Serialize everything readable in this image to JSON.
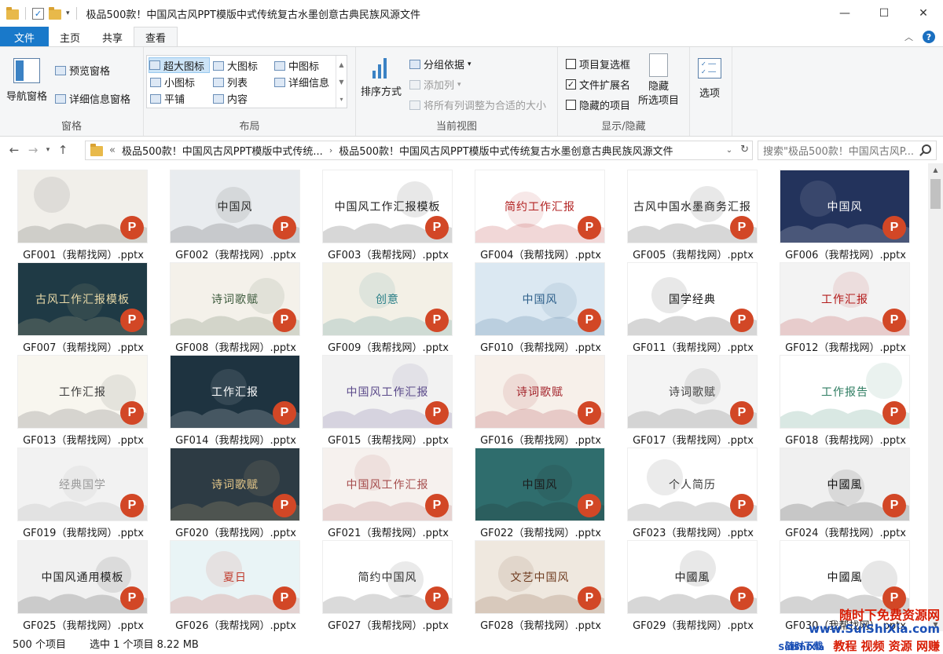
{
  "window": {
    "title": "极品500款！中国风古风PPT模版中式传统复古水墨创意古典民族风源文件",
    "controls": {
      "minimize": "—",
      "maximize": "☐",
      "close": "✕"
    }
  },
  "ribbon_tabs": [
    "文件",
    "主页",
    "共享",
    "查看"
  ],
  "ribbon": {
    "panes": {
      "label": "窗格",
      "nav_pane": "导航窗格",
      "preview_pane": "预览窗格",
      "details_pane": "详细信息窗格"
    },
    "layout": {
      "label": "布局",
      "options": [
        "超大图标",
        "大图标",
        "中图标",
        "小图标",
        "列表",
        "详细信息",
        "平铺",
        "内容"
      ],
      "selected": "超大图标"
    },
    "current_view": {
      "label": "当前视图",
      "sort_by": "排序方式",
      "group_by": "分组依据",
      "add_columns": "添加列",
      "size_all_columns": "将所有列调整为合适的大小"
    },
    "show_hide": {
      "label": "显示/隐藏",
      "item_checkboxes": {
        "label": "项目复选框",
        "checked": false
      },
      "file_extensions": {
        "label": "文件扩展名",
        "checked": true
      },
      "hidden_items": {
        "label": "隐藏的项目",
        "checked": false
      },
      "hide_selected": "隐藏\n所选项目"
    },
    "options": "选项"
  },
  "address": {
    "crumb_prefix": "«",
    "crumb1": "极品500款！中国风古风PPT模版中式传统...",
    "crumb2": "极品500款！中国风古风PPT模版中式传统复古水墨创意古典民族风源文件",
    "search_placeholder": "搜索\"极品500款！中国风古风P..."
  },
  "files": [
    {
      "name": "GF001（我帮找网）.pptx",
      "thumb_text": "",
      "bg": "#f1efea",
      "accent": "#3a3a3a"
    },
    {
      "name": "GF002（我帮找网）.pptx",
      "thumb_text": "中国风",
      "bg": "#e9ecef",
      "accent": "#2b2b2b"
    },
    {
      "name": "GF003（我帮找网）.pptx",
      "thumb_text": "中国风工作汇报模板",
      "bg": "#ffffff",
      "accent": "#222222"
    },
    {
      "name": "GF004（我帮找网）.pptx",
      "thumb_text": "简约工作汇报",
      "bg": "#ffffff",
      "accent": "#b22222"
    },
    {
      "name": "GF005（我帮找网）.pptx",
      "thumb_text": "古风中国水墨商务汇报",
      "bg": "#ffffff",
      "accent": "#222222"
    },
    {
      "name": "GF006（我帮找网）.pptx",
      "thumb_text": "中国风",
      "bg": "#23335c",
      "accent": "#ffffff"
    },
    {
      "name": "GF007（我帮找网）.pptx",
      "thumb_text": "古风工作汇报模板",
      "bg": "#1f3a45",
      "accent": "#e8d9a8"
    },
    {
      "name": "GF008（我帮找网）.pptx",
      "thumb_text": "诗词歌赋",
      "bg": "#f4f1ea",
      "accent": "#3c5a3c"
    },
    {
      "name": "GF009（我帮找网）.pptx",
      "thumb_text": "创意",
      "bg": "#f3f0e6",
      "accent": "#2a7f87"
    },
    {
      "name": "GF010（我帮找网）.pptx",
      "thumb_text": "中国风",
      "bg": "#dbe8f2",
      "accent": "#2d5f8a"
    },
    {
      "name": "GF011（我帮找网）.pptx",
      "thumb_text": "国学经典",
      "bg": "#ffffff",
      "accent": "#1b1b1b"
    },
    {
      "name": "GF012（我帮找网）.pptx",
      "thumb_text": "工作汇报",
      "bg": "#f3f3f3",
      "accent": "#b31b1b"
    },
    {
      "name": "GF013（我帮找网）.pptx",
      "thumb_text": "工作汇报",
      "bg": "#f8f6ef",
      "accent": "#3b3b3b"
    },
    {
      "name": "GF014（我帮找网）.pptx",
      "thumb_text": "工作汇报",
      "bg": "#1e3340",
      "accent": "#ffffff"
    },
    {
      "name": "GF015（我帮找网）.pptx",
      "thumb_text": "中国风工作汇报",
      "bg": "#f2f2f2",
      "accent": "#5b4a8a"
    },
    {
      "name": "GF016（我帮找网）.pptx",
      "thumb_text": "诗词歌赋",
      "bg": "#f7f0ea",
      "accent": "#a3232b"
    },
    {
      "name": "GF017（我帮找网）.pptx",
      "thumb_text": "诗词歌赋",
      "bg": "#f4f4f4",
      "accent": "#444444"
    },
    {
      "name": "GF018（我帮找网）.pptx",
      "thumb_text": "工作报告",
      "bg": "#ffffff",
      "accent": "#2f7d62"
    },
    {
      "name": "GF019（我帮找网）.pptx",
      "thumb_text": "经典国学",
      "bg": "#f2f2f2",
      "accent": "#9a9a9a"
    },
    {
      "name": "GF020（我帮找网）.pptx",
      "thumb_text": "诗词歌赋",
      "bg": "#2d3b44",
      "accent": "#e7c98a"
    },
    {
      "name": "GF021（我帮找网）.pptx",
      "thumb_text": "中国风工作汇报",
      "bg": "#f6f1ee",
      "accent": "#a54c4c"
    },
    {
      "name": "GF022（我帮找网）.pptx",
      "thumb_text": "中国风",
      "bg": "#2f6d6d",
      "accent": "#1b1b1b"
    },
    {
      "name": "GF023（我帮找网）.pptx",
      "thumb_text": "个人简历",
      "bg": "#ffffff",
      "accent": "#3b3b3b"
    },
    {
      "name": "GF024（我帮找网）.pptx",
      "thumb_text": "中國風",
      "bg": "#f0f0f0",
      "accent": "#111111"
    },
    {
      "name": "GF025（我帮找网）.pptx",
      "thumb_text": "中国风通用模板",
      "bg": "#f1f1f1",
      "accent": "#222222"
    },
    {
      "name": "GF026（我帮找网）.pptx",
      "thumb_text": "夏日",
      "bg": "#e9f4f6",
      "accent": "#c0392b"
    },
    {
      "name": "GF027（我帮找网）.pptx",
      "thumb_text": "简约中国风",
      "bg": "#ffffff",
      "accent": "#333333"
    },
    {
      "name": "GF028（我帮找网）.pptx",
      "thumb_text": "文艺中国风",
      "bg": "#efe8df",
      "accent": "#6e3b1f"
    },
    {
      "name": "GF029（我帮找网）.pptx",
      "thumb_text": "中國風",
      "bg": "#ffffff",
      "accent": "#222222"
    },
    {
      "name": "GF030（我帮找网）.pptx",
      "thumb_text": "中國風",
      "bg": "#ffffff",
      "accent": "#111111"
    }
  ],
  "status": {
    "count": "500 个项目",
    "selection": "选中 1 个项目  8.22 MB"
  },
  "watermark": {
    "line1": "随时下免费资源网",
    "line2_prefix": "随时下载",
    "line2": "www.SuiShiXia.com",
    "line3_prefix": "SuiShiXia",
    "line3": "教程 视频 资源 网赚"
  },
  "colors": {
    "accent": "#1979ca",
    "ppt_badge": "#d24726"
  }
}
